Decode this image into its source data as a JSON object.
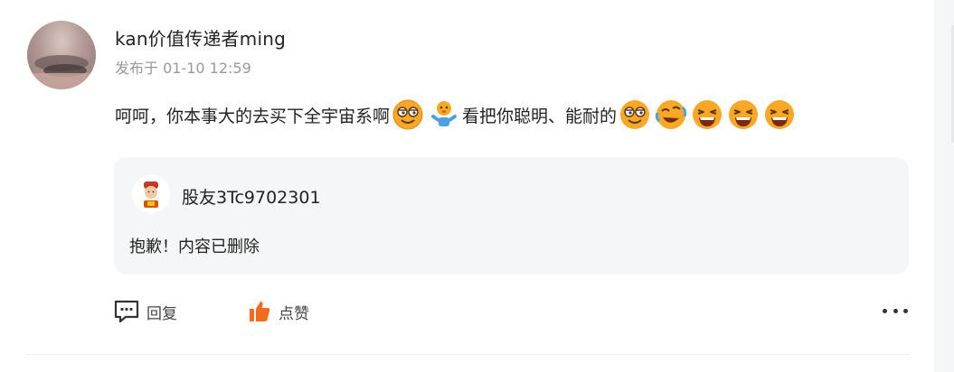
{
  "post": {
    "author": "kan价值传递者ming",
    "time": "发布于 01-10 12:59",
    "text_part1": "呵呵，你本事大的去买下全宇宙系啊",
    "text_part2": "看把你聪明、能耐的",
    "emojis_after_part1": [
      "sly-grin-emoji",
      "shrug-emoji"
    ],
    "emojis_after_part2": [
      "sly-grin-emoji",
      "laugh-cry-emoji",
      "big-laugh-emoji",
      "big-laugh-emoji",
      "big-laugh-emoji"
    ]
  },
  "quote": {
    "author": "股友3Tc9702301",
    "text": "抱歉！内容已删除"
  },
  "actions": {
    "reply_label": "回复",
    "like_label": "点赞"
  },
  "colors": {
    "accent_orange": "#f56a1b",
    "muted_text": "#999999",
    "card_bg": "#f5f6f7"
  }
}
